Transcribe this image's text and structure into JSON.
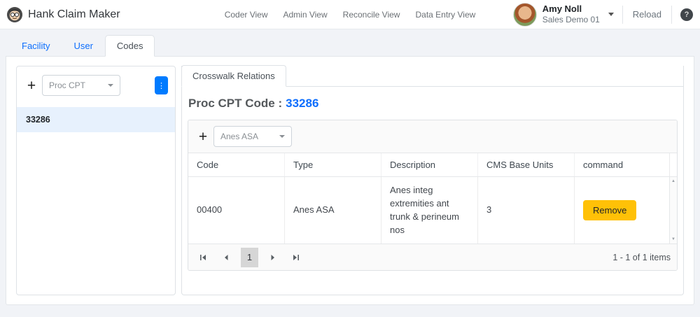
{
  "header": {
    "app_title": "Hank Claim Maker",
    "nav": [
      "Coder View",
      "Admin View",
      "Reconcile View",
      "Data Entry View"
    ],
    "user": {
      "name": "Amy Noll",
      "org": "Sales Demo 01"
    },
    "reload_label": "Reload"
  },
  "tabs": {
    "items": [
      {
        "label": "Facility",
        "active": false
      },
      {
        "label": "User",
        "active": false
      },
      {
        "label": "Codes",
        "active": true
      }
    ]
  },
  "left_panel": {
    "type_dropdown": {
      "value": "Proc CPT"
    },
    "list": [
      {
        "code": "33286",
        "selected": true
      }
    ]
  },
  "right_panel": {
    "tab_label": "Crosswalk Relations",
    "heading_label": "Proc CPT Code :",
    "heading_code": "33286",
    "toolbar_dropdown": {
      "value": "Anes ASA"
    },
    "grid": {
      "columns": [
        "Code",
        "Type",
        "Description",
        "CMS Base Units",
        "command"
      ],
      "rows": [
        {
          "code": "00400",
          "type": "Anes ASA",
          "description": "Anes integ extremities ant trunk & perineum nos",
          "cms_base_units": "3",
          "command_label": "Remove"
        }
      ],
      "pager": {
        "current_page": "1",
        "summary": "1 - 1 of 1 items"
      }
    }
  },
  "icons": {
    "plus": "+",
    "more_vertical": "⋮",
    "help": "?",
    "scroll_up": "▲",
    "scroll_down": "▼"
  },
  "colors": {
    "accent_blue": "#0d6efd",
    "primary_button_blue": "#007bff",
    "warning_yellow": "#ffc107",
    "selected_row_bg": "#e7f1fd"
  }
}
